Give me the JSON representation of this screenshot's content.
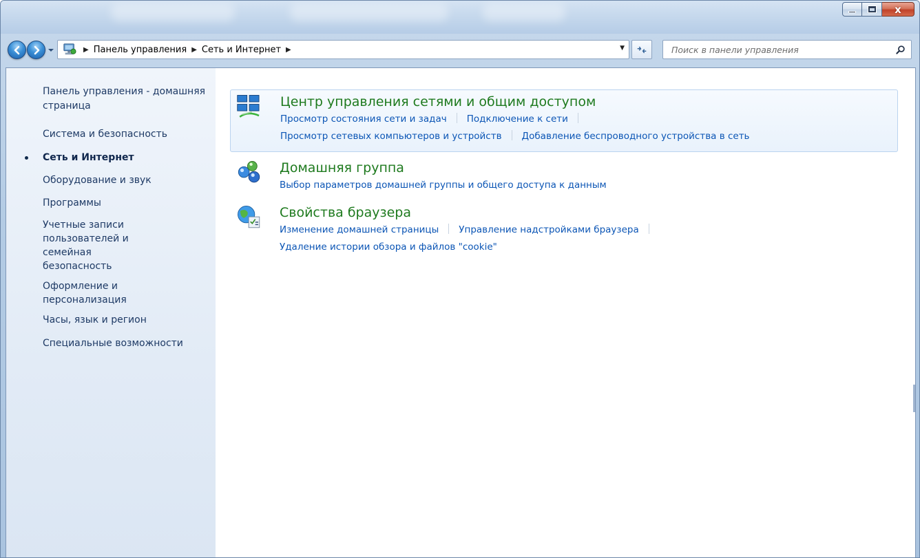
{
  "window": {
    "caption_buttons": {
      "minimize": "minimize",
      "maximize": "maximize",
      "close": "x"
    }
  },
  "navigation": {
    "breadcrumbs": [
      "Панель управления",
      "Сеть и Интернет"
    ],
    "search_placeholder": "Поиск в панели управления"
  },
  "sidebar": {
    "items": [
      {
        "label": "Панель управления - домашняя страница",
        "current": false
      },
      {
        "label": "Система и безопасность",
        "current": false
      },
      {
        "label": "Сеть и Интернет",
        "current": true
      },
      {
        "label": "Оборудование и звук",
        "current": false
      },
      {
        "label": "Программы",
        "current": false
      },
      {
        "label": "Учетные записи пользователей и семейная безопасность",
        "current": false
      },
      {
        "label": "Оформление и персонализация",
        "current": false
      },
      {
        "label": "Часы, язык и регион",
        "current": false
      },
      {
        "label": "Специальные возможности",
        "current": false
      }
    ]
  },
  "categories": [
    {
      "title": "Центр управления сетями и общим доступом",
      "icon": "network-center-icon",
      "links": [
        "Просмотр состояния сети и задач",
        "Подключение к сети",
        "Просмотр сетевых компьютеров и устройств",
        "Добавление беспроводного устройства в сеть"
      ]
    },
    {
      "title": "Домашняя группа",
      "icon": "homegroup-icon",
      "links": [
        "Выбор параметров домашней группы и общего доступа к данным"
      ]
    },
    {
      "title": "Свойства браузера",
      "icon": "internet-options-icon",
      "links": [
        "Изменение домашней страницы",
        "Управление надстройками браузера",
        "Удаление истории обзора и файлов \"cookie\""
      ]
    }
  ],
  "colors": {
    "category_title": "#1e7a1e",
    "link": "#0b55b5",
    "sidebar_text": "#1e3a65"
  }
}
